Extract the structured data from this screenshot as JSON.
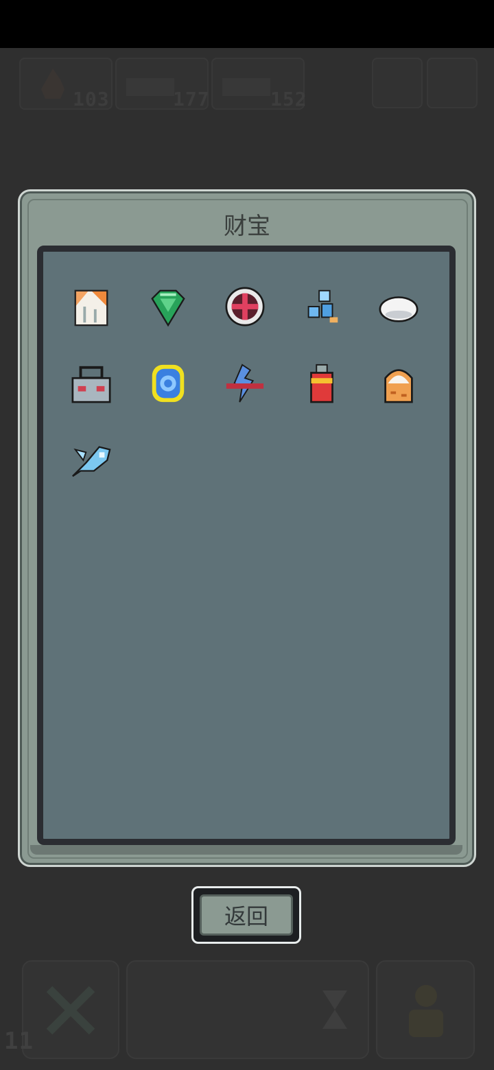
{
  "hud": {
    "counter_a": "103",
    "counter_b": "177",
    "counter_c": "152",
    "bottom_left_level": "11"
  },
  "dialog": {
    "title": "财宝",
    "back_label": "返回"
  },
  "items": [
    {
      "icon": "torn-scroll-icon"
    },
    {
      "icon": "green-gem-icon"
    },
    {
      "icon": "crosshair-shield-icon"
    },
    {
      "icon": "blue-crystal-cluster-icon"
    },
    {
      "icon": "white-pebble-icon"
    },
    {
      "icon": "gray-bag-icon"
    },
    {
      "icon": "blue-ring-icon"
    },
    {
      "icon": "lightning-blade-icon"
    },
    {
      "icon": "red-battery-icon"
    },
    {
      "icon": "orange-pudding-icon"
    },
    {
      "icon": "ice-fish-icon"
    }
  ],
  "colors": {
    "panel": "#5f7278",
    "frame": "#8b9a92",
    "background": "#2f2f2f"
  }
}
